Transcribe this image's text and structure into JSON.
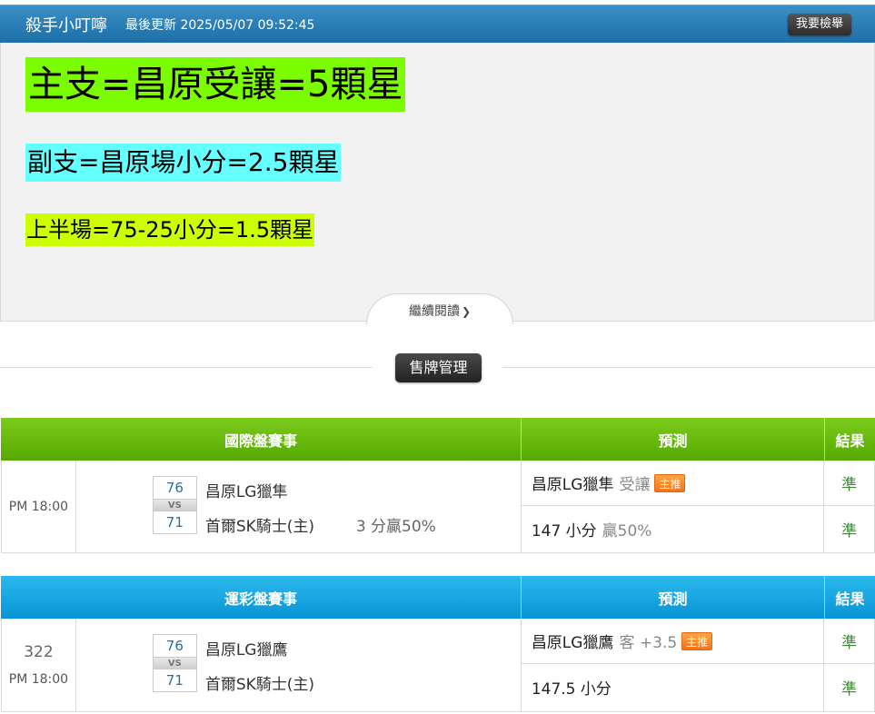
{
  "header": {
    "name": "殺手小叮嚀",
    "updated": "最後更新 2025/05/07 09:52:45",
    "report_button": "我要檢舉"
  },
  "article": {
    "line1": "主支=昌原受讓=5顆星",
    "line2": "副支=昌原場小分=2.5顆星",
    "line3": "上半場=75-25小分=1.5顆星",
    "read_more": "繼續閱讀"
  },
  "manage_button": "售牌管理",
  "tables": [
    {
      "headers": {
        "match": "國際盤賽事",
        "prediction": "預測",
        "result": "結果"
      },
      "time_code": "",
      "time": "PM 18:00",
      "score_home": "76",
      "vs": "VS",
      "score_away": "71",
      "team_a": "昌原LG獵隼",
      "team_b": "首爾SK騎士(主)",
      "extra": "3 分贏50%",
      "predictions": [
        {
          "main": "昌原LG獵隼",
          "sub": "受讓",
          "badge": "主推",
          "result": "準"
        },
        {
          "main": "147 小分",
          "sub": "贏50%",
          "badge": "",
          "result": "準"
        }
      ],
      "colors": {
        "header_top": "#7ccc1c",
        "header_bottom": "#56a800"
      }
    },
    {
      "headers": {
        "match": "運彩盤賽事",
        "prediction": "預測",
        "result": "結果"
      },
      "time_code": "322",
      "time": "PM 18:00",
      "score_home": "76",
      "vs": "VS",
      "score_away": "71",
      "team_a": "昌原LG獵鷹",
      "team_b": "首爾SK騎士(主)",
      "extra": "",
      "predictions": [
        {
          "main": "昌原LG獵鷹",
          "sub": "客 +3.5",
          "badge": "主推",
          "result": "準"
        },
        {
          "main": "147.5 小分",
          "sub": "",
          "badge": "",
          "result": "準"
        }
      ],
      "colors": {
        "header_top": "#2cb9ee",
        "header_bottom": "#0893d4"
      }
    }
  ],
  "icons": {
    "read_more": "chevron-down-icon"
  },
  "colors": {
    "topbar": "#1d6fa6",
    "highlight1": "#7cfc00",
    "highlight2": "#66ffff",
    "highlight3": "#ccff00",
    "badge": "#f0741a",
    "result_text": "#3a8a33"
  }
}
